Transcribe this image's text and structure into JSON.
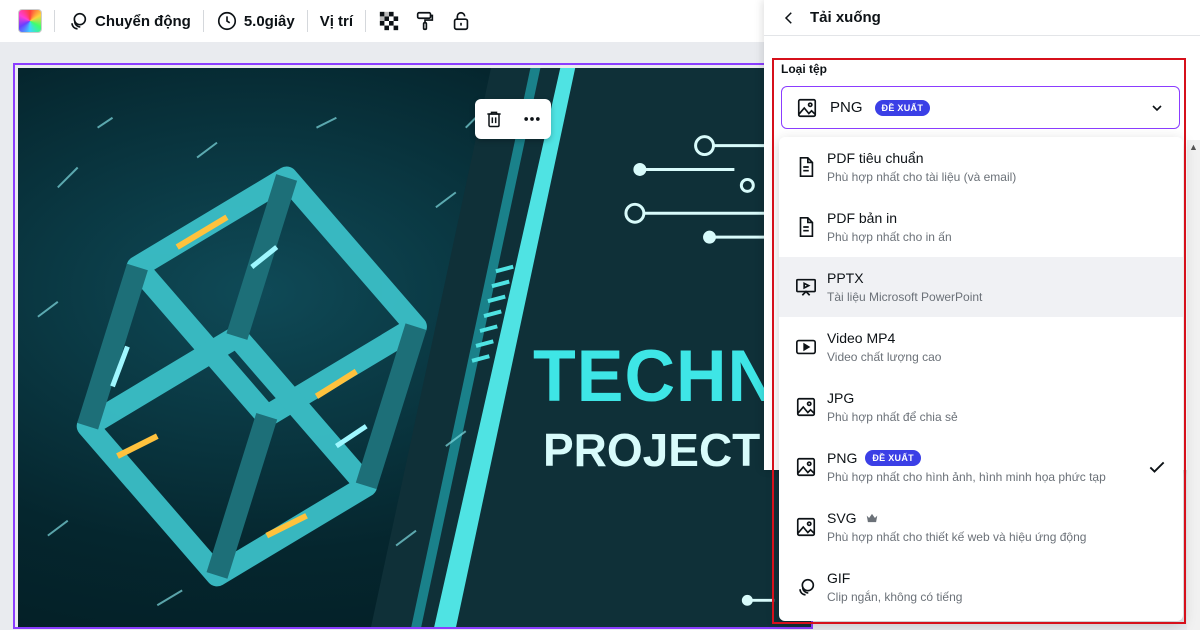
{
  "toolbar": {
    "animate_label": "Chuyển động",
    "duration_label": "5.0giây",
    "position_label": "Vị trí"
  },
  "canvas": {
    "title_text": "TECHNO",
    "subtitle_text": "PROJECT P"
  },
  "panel": {
    "header_title": "Tải xuống",
    "file_type_label": "Loại tệp",
    "selected_value": "PNG",
    "selected_badge": "ĐỀ XUẤT",
    "options": [
      {
        "name": "PDF tiêu chuẩn",
        "desc": "Phù hợp nhất cho tài liệu (và email)",
        "icon": "document-icon"
      },
      {
        "name": "PDF bản in",
        "desc": "Phù hợp nhất cho in ấn",
        "icon": "document-icon"
      },
      {
        "name": "PPTX",
        "desc": "Tài liệu Microsoft PowerPoint",
        "icon": "presentation-icon"
      },
      {
        "name": "Video MP4",
        "desc": "Video chất lượng cao",
        "icon": "video-icon"
      },
      {
        "name": "JPG",
        "desc": "Phù hợp nhất để chia sẻ",
        "icon": "image-icon"
      },
      {
        "name": "PNG",
        "badge": "ĐỀ XUẤT",
        "desc": "Phù hợp nhất cho hình ảnh, hình minh họa phức tạp",
        "icon": "image-icon",
        "selected": true
      },
      {
        "name": "SVG",
        "desc": "Phù hợp nhất cho thiết kế web và hiệu ứng động",
        "icon": "image-icon",
        "premium": true
      },
      {
        "name": "GIF",
        "desc": "Clip ngắn, không có tiếng",
        "icon": "gif-icon"
      }
    ]
  },
  "colors": {
    "accent": "#8b3dff",
    "badge": "#3b3fe6",
    "highlight_border": "#d6101b",
    "title_cyan": "#3ee6e6"
  }
}
